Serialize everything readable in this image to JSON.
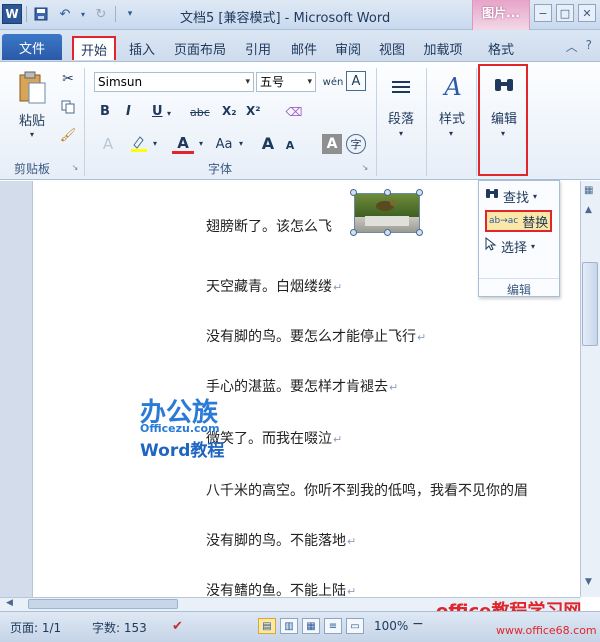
{
  "titlebar": {
    "app_letter": "W",
    "title": "文档5 [兼容模式] - Microsoft Word",
    "context_tab_group": "图片...",
    "minimize": "−",
    "restore": "□",
    "close": "✕"
  },
  "tabs": {
    "file": "文件",
    "home": "开始",
    "insert": "插入",
    "page_layout": "页面布局",
    "references": "引用",
    "mailings": "邮件",
    "review": "审阅",
    "view": "视图",
    "addins": "加载项",
    "format": "格式"
  },
  "ribbon": {
    "clipboard": {
      "paste": "粘贴",
      "label": "剪贴板"
    },
    "font": {
      "font_name": "Simsun",
      "font_size": "五号",
      "bold": "B",
      "italic": "I",
      "underline": "U",
      "strike": "abc",
      "subscript": "X₂",
      "superscript": "X²",
      "font_color": "A",
      "change_case": "Aa",
      "grow": "A",
      "shrink": "A",
      "char_border": "A",
      "label": "字体"
    },
    "paragraph": {
      "label": "段落"
    },
    "styles": {
      "label": "样式"
    },
    "editing": {
      "label": "编辑"
    }
  },
  "editing_panel": {
    "find": "查找",
    "replace": "替换",
    "select": "选择",
    "label": "编辑"
  },
  "document": {
    "lines": [
      "翅膀断了。该怎么飞",
      "天空藏青。白烟缕缕",
      "没有脚的鸟。要怎么才能停止飞行",
      "手心的湛蓝。要怎样才肯褪去",
      "微笑了。而我在啜泣",
      "八千米的高空。你听不到我的低鸣，我看不见你的眉",
      "没有脚的鸟。不能落地",
      "没有鳍的鱼。不能上陆"
    ],
    "para_mark": "↵"
  },
  "watermark": {
    "line1": "办公族",
    "line2": "Officezu.com",
    "line3": "Word教程"
  },
  "status": {
    "page": "页面: 1/1",
    "words": "字数: 153",
    "zoom": "100%",
    "minus": "−"
  },
  "site_watermark": {
    "name": "office教程学习网",
    "url": "www.office68.com"
  }
}
